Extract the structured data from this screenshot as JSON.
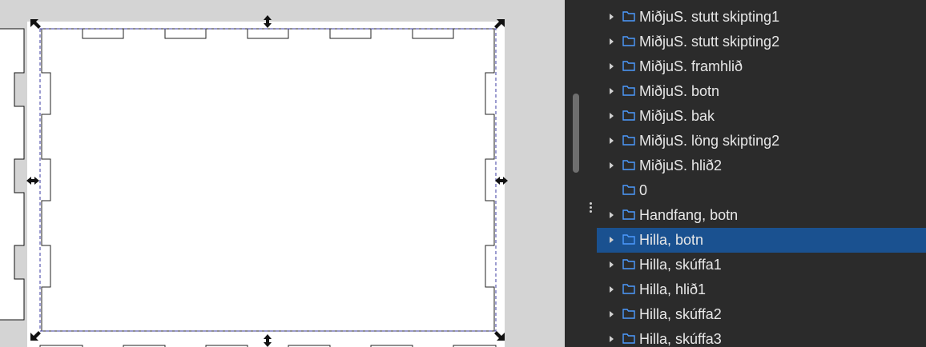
{
  "layers_panel": {
    "items": [
      {
        "label": "MiðjuS. stutt skipting1",
        "expandable": true,
        "selected": false
      },
      {
        "label": "MiðjuS. stutt skipting2",
        "expandable": true,
        "selected": false
      },
      {
        "label": "MiðjuS. framhlið",
        "expandable": true,
        "selected": false
      },
      {
        "label": "MiðjuS. botn",
        "expandable": true,
        "selected": false
      },
      {
        "label": "MiðjuS. bak",
        "expandable": true,
        "selected": false
      },
      {
        "label": "MiðjuS. löng skipting2",
        "expandable": true,
        "selected": false
      },
      {
        "label": "MiðjuS. hlið2",
        "expandable": true,
        "selected": false
      },
      {
        "label": "0",
        "expandable": false,
        "selected": false
      },
      {
        "label": "Handfang, botn",
        "expandable": true,
        "selected": false
      },
      {
        "label": "Hilla, botn",
        "expandable": true,
        "selected": true
      },
      {
        "label": "Hilla, skúffa1",
        "expandable": true,
        "selected": false
      },
      {
        "label": "Hilla, hlið1",
        "expandable": true,
        "selected": false
      },
      {
        "label": "Hilla, skúffa2",
        "expandable": true,
        "selected": false
      },
      {
        "label": "Hilla, skúffa3",
        "expandable": true,
        "selected": false
      }
    ],
    "icons": {
      "expand": "caret-right-icon",
      "folder": "folder-icon"
    }
  },
  "colors": {
    "canvas_bg": "#d4d4d4",
    "panel_bg": "#2b2b2b",
    "selection": "#1a5190",
    "folder_icon": "#4c9bff",
    "bbox_dash": "#3a3aa0"
  }
}
